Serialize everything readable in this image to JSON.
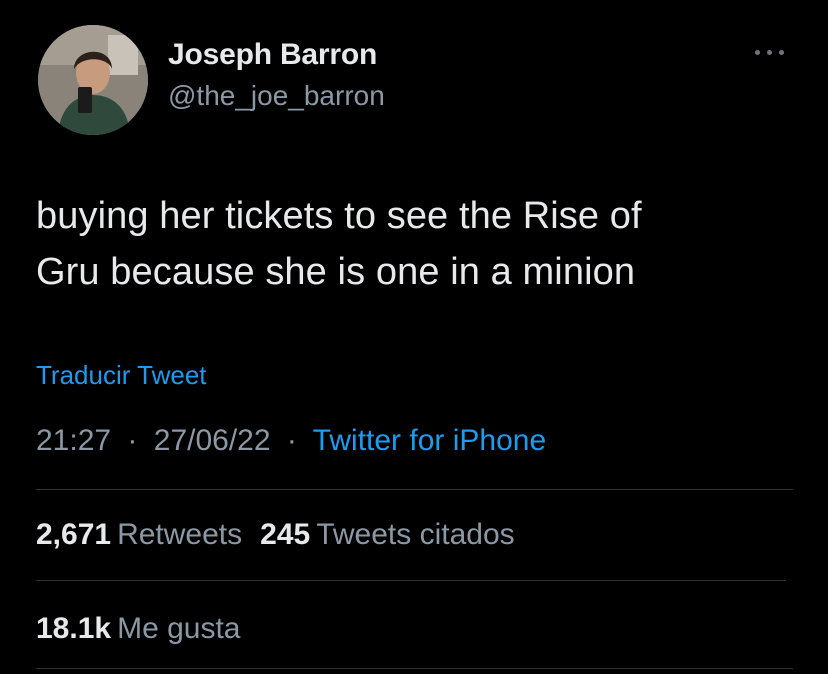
{
  "author": {
    "name": "Joseph Barron",
    "handle": "@the_joe_barron",
    "avatar_icon": "profile-photo"
  },
  "more_icon": "more-options-icon",
  "tweet": {
    "text_line1": "buying her tickets to see the Rise of",
    "text_line2": "Gru because she is one in a minion"
  },
  "translate_label": "Traducir Tweet",
  "meta": {
    "time": "21:27",
    "date": "27/06/22",
    "separator": "·",
    "source": "Twitter for iPhone"
  },
  "stats": {
    "retweets_count": "2,671",
    "retweets_label": "Retweets",
    "quotes_count": "245",
    "quotes_label": "Tweets citados",
    "likes_count": "18.1k",
    "likes_label": "Me gusta"
  },
  "colors": {
    "background": "#000000",
    "primary_text": "#e7e9ea",
    "secondary_text": "#8b98a5",
    "link": "#1d9bf0",
    "divider": "#2f3336"
  }
}
